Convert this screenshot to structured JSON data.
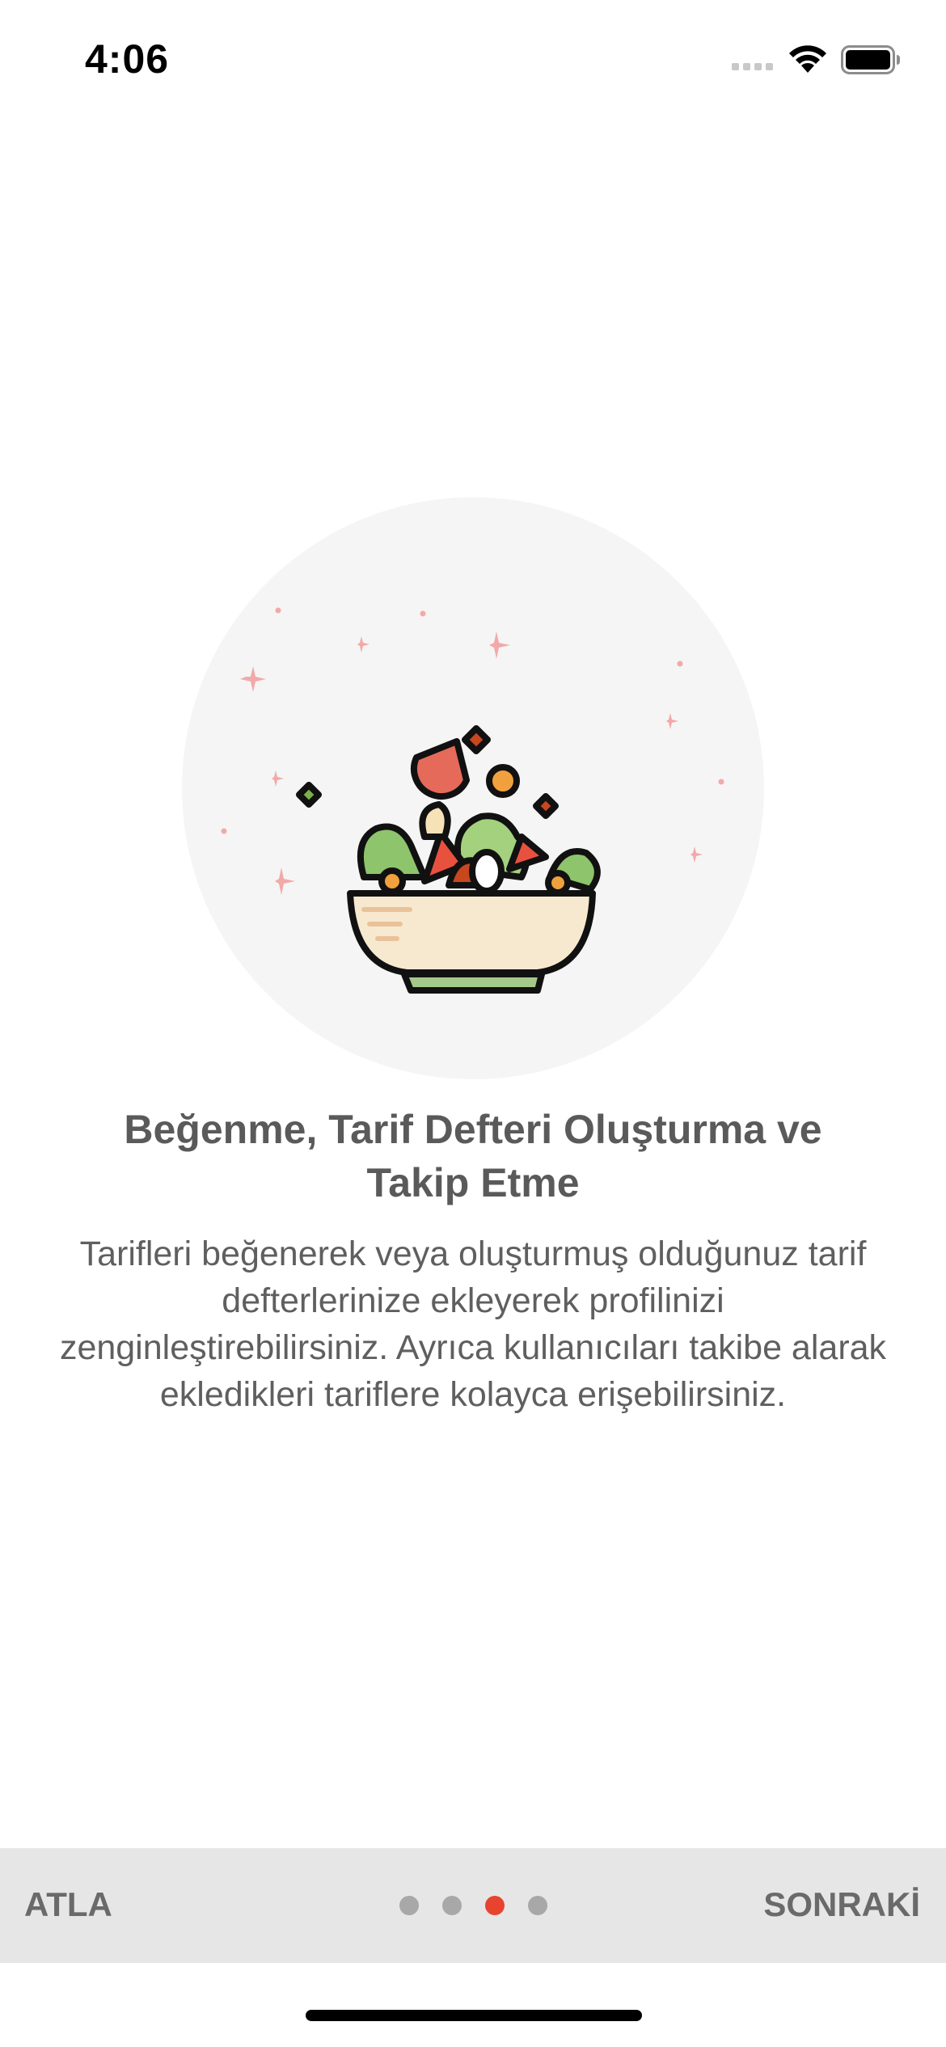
{
  "status_bar": {
    "time": "4:06"
  },
  "onboarding": {
    "title": "Beğenme, Tarif Defteri Oluşturma ve Takip Etme",
    "description": "Tarifleri beğenerek veya oluşturmuş olduğunuz tarif defterlerinize ekleyerek profilinizi zenginleştirebilirsiniz. Ayrıca kullanıcıları takibe alarak ekledikleri tariflere kolayca erişebilirsiniz.",
    "illustration_icon": "salad-bowl-icon"
  },
  "navigation": {
    "skip_label": "ATLA",
    "next_label": "SONRAKİ",
    "total_pages": 4,
    "current_page": 3
  },
  "colors": {
    "accent": "#e8432e",
    "dot_inactive": "#a8a8a8",
    "bottom_bar": "#e6e6e6",
    "text": "#5a5a5a",
    "circle_bg": "#f5f5f5",
    "sparkle": "#f2a9a9"
  }
}
